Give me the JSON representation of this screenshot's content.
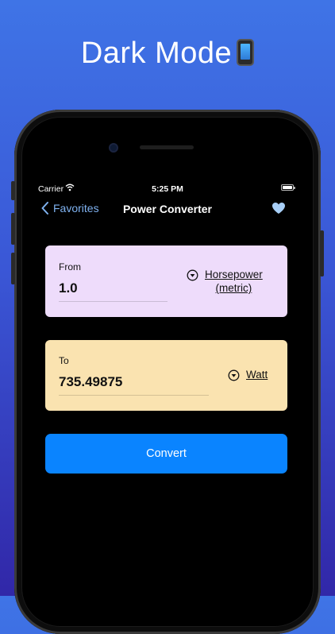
{
  "headline": "Dark Mode",
  "status_bar": {
    "carrier": "Carrier",
    "time": "5:25 PM"
  },
  "nav": {
    "back_label": "Favorites",
    "title": "Power Converter"
  },
  "from_card": {
    "label": "From",
    "value": "1.0",
    "unit_line1": "Horsepower",
    "unit_line2": "(metric)"
  },
  "to_card": {
    "label": "To",
    "value": "735.49875",
    "unit": "Watt"
  },
  "convert_label": "Convert",
  "colors": {
    "accent": "#0a84ff",
    "from_card_bg": "#eedcfb",
    "to_card_bg": "#fae3b0",
    "back_link": "#7fb2f0",
    "heart": "#a8cff7"
  },
  "icons": [
    "mobile-phone-icon",
    "wifi-icon",
    "battery-icon",
    "chevron-left-icon",
    "heart-icon",
    "dropdown-circle-icon"
  ]
}
